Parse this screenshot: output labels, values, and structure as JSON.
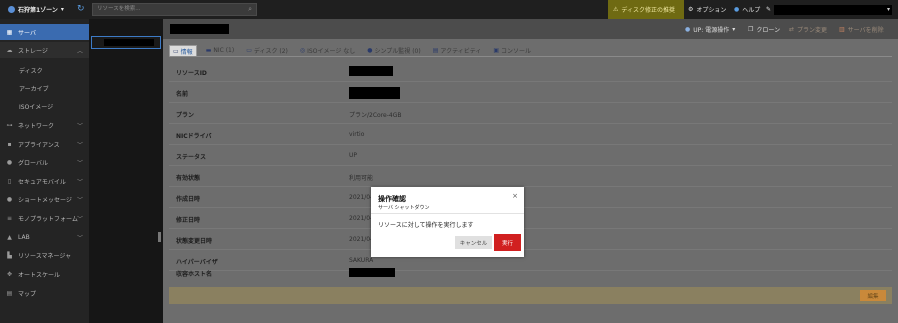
{
  "topbar": {
    "zone": "石狩第1ゾーン",
    "search_placeholder": "リソースを検索...",
    "alert": "ディスク修正の推奨",
    "options": "オプション",
    "help": "ヘルプ"
  },
  "sidebar": {
    "items": [
      {
        "label": "サーバ",
        "icon": "server-icon"
      },
      {
        "label": "ストレージ",
        "icon": "cloud-icon"
      },
      {
        "label": "ディスク"
      },
      {
        "label": "アーカイブ"
      },
      {
        "label": "ISOイメージ"
      },
      {
        "label": "ネットワーク",
        "icon": "network-icon"
      },
      {
        "label": "アプライアンス",
        "icon": "appliance-icon"
      },
      {
        "label": "グローバル",
        "icon": "globe-icon"
      },
      {
        "label": "セキュアモバイル",
        "icon": "mobile-icon"
      },
      {
        "label": "ショートメッセージ",
        "icon": "message-icon"
      },
      {
        "label": "モノプラットフォーム",
        "icon": "platform-icon"
      },
      {
        "label": "LAB",
        "icon": "lab-icon"
      },
      {
        "label": "リソースマネージャ",
        "icon": "resource-manager-icon"
      },
      {
        "label": "オートスケール",
        "icon": "autoscale-icon"
      },
      {
        "label": "マップ",
        "icon": "map-icon"
      }
    ]
  },
  "main": {
    "actions": {
      "power": "UP: 電源操作",
      "clone": "クローン",
      "plan_change": "プラン変更",
      "delete": "サーバを削除"
    },
    "tabs": [
      {
        "label": "情報"
      },
      {
        "label": "NIC (1)"
      },
      {
        "label": "ディスク (2)"
      },
      {
        "label": "ISOイメージ なし"
      },
      {
        "label": "シンプル監視 (0)"
      },
      {
        "label": "アクティビティ"
      },
      {
        "label": "コンソール"
      }
    ],
    "rows": [
      {
        "label": "リソースID",
        "value": ""
      },
      {
        "label": "名前",
        "value": ""
      },
      {
        "label": "プラン",
        "value": "プラン/2Core-4GB"
      },
      {
        "label": "NICドライバ",
        "value": "virtio"
      },
      {
        "label": "ステータス",
        "value": "UP"
      },
      {
        "label": "有効状態",
        "value": "利用可能"
      },
      {
        "label": "作成日時",
        "value": "2021/04"
      },
      {
        "label": "修正日時",
        "value": "2021/04"
      },
      {
        "label": "状態変更日時",
        "value": "2021/04"
      },
      {
        "label": "ハイパーバイザ",
        "value": "SAKURA"
      },
      {
        "label": "収容ホスト名",
        "value": ""
      }
    ],
    "edit_button": "編集"
  },
  "dialog": {
    "title": "操作確認",
    "subtitle": "サーバ シャットダウン",
    "message": "リソースに対して操作を実行します",
    "cancel": "キャンセル",
    "execute": "実行",
    "close": "×"
  }
}
